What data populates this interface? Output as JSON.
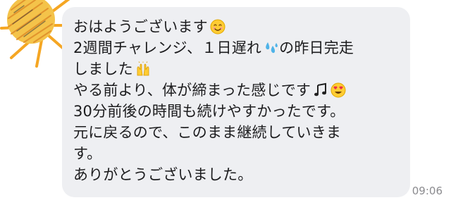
{
  "message": {
    "lines": [
      {
        "text": "おはようございます",
        "emoji": "smiling-face-icon"
      },
      {
        "text": "2週間チャレンジ、１日遅れ",
        "emoji": "sweat-droplets-icon",
        "text_after": "の昨日完走"
      },
      {
        "text": "しました",
        "emoji": "raising-hands-icon"
      },
      {
        "text": "やる前より、体が締まった感じです",
        "emoji": "music-note-icon",
        "emoji2": "heart-eyes-icon"
      },
      {
        "text": "30分前後の時間も続けやすかったです。"
      },
      {
        "text": "元に戻るので、このまま継続していきま"
      },
      {
        "text": "す。"
      },
      {
        "text": "ありがとうございました。"
      }
    ],
    "timestamp": "09:06"
  },
  "colors": {
    "bubble": "#eeeff2",
    "text": "#1c1c1e",
    "timestamp": "#8b8b8f",
    "sun": "#f5a623"
  }
}
